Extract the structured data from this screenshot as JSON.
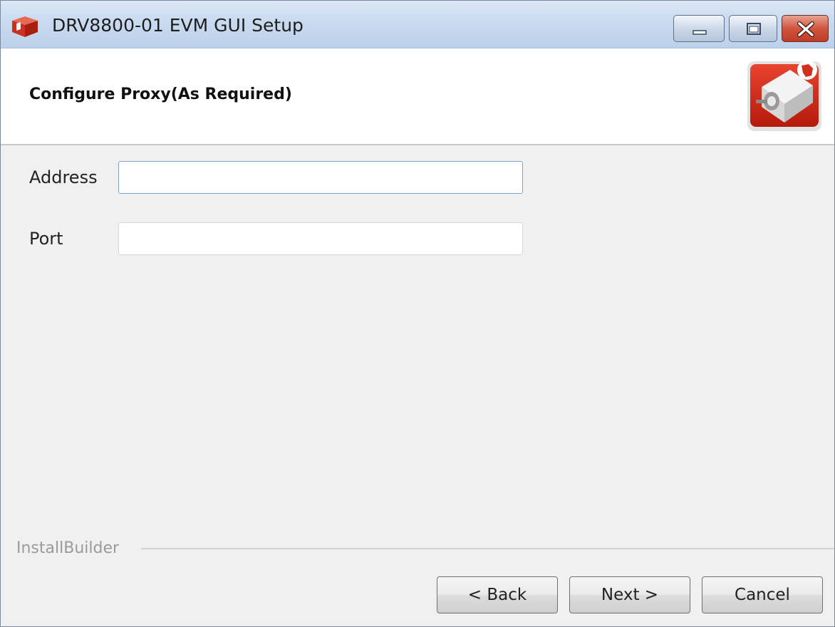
{
  "window": {
    "title": "DRV8800-01 EVM GUI Setup",
    "app_icon": "installer-box-icon",
    "controls": {
      "minimize_icon": "minimize-icon",
      "maximize_icon": "maximize-icon",
      "close_icon": "close-icon"
    }
  },
  "header": {
    "title": "Configure Proxy(As Required)",
    "logo_icon": "ti-motor-logo-icon"
  },
  "form": {
    "address": {
      "label": "Address",
      "value": ""
    },
    "port": {
      "label": "Port",
      "value": ""
    }
  },
  "footer": {
    "brand": "InstallBuilder",
    "back_label": "< Back",
    "next_label": "Next >",
    "cancel_label": "Cancel"
  },
  "colors": {
    "accent_red": "#d22f1e",
    "titlebar": "#c9daef",
    "background": "#f0f0f0"
  }
}
